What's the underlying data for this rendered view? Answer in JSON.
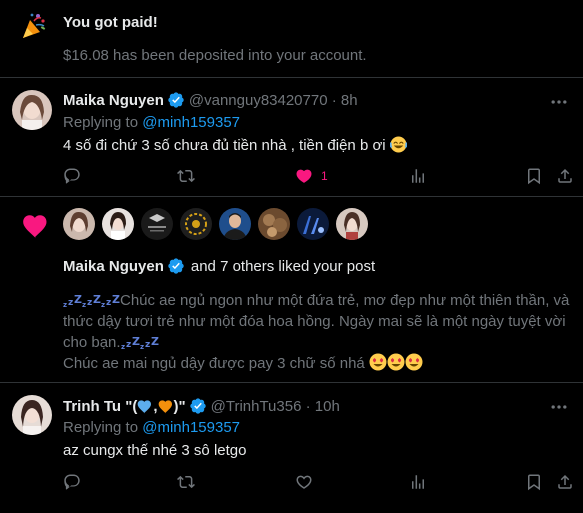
{
  "paid": {
    "title": "You got paid!",
    "description": "$16.08 has been deposited into your account."
  },
  "tweet1": {
    "name": "Maika Nguyen",
    "handle": "@vannguy83420770 · 8h",
    "replying_prefix": "Replying to ",
    "replying_mention": "@minh159357",
    "text": "4 số đi chứ 3 số chưa đủ tiền nhà , tiền điện b ơi",
    "like_count": "1"
  },
  "likes": {
    "name": "Maika Nguyen",
    "summary": "and 7 others liked your post",
    "post_line1": "Chúc ae ngủ ngon như một đứa trẻ, mơ đẹp như một thiên thần, và",
    "post_line2": "thức dậy tươi trẻ như một đóa hoa hồng. Ngày mai sẽ là một ngày tuyệt vời",
    "post_line3": "cho bạn.",
    "post_line4": "Chúc ae mai ngủ dậy được pay 3 chữ số nhá"
  },
  "tweet2": {
    "name": "Trinh Tu \"(",
    "name_mid": ",",
    "name_end": ")\"",
    "handle": "@TrinhTu356 · 10h",
    "replying_prefix": "Replying to ",
    "replying_mention": "@minh159357",
    "text": "az cungx thế nhé 3 sô letgo"
  },
  "icons": [
    "party-popper-icon",
    "verified-badge-icon",
    "more-icon",
    "reply-icon",
    "retweet-icon",
    "like-icon",
    "analytics-icon",
    "bookmark-icon",
    "share-icon",
    "heart-filled-icon",
    "sleeping-zzz-icon",
    "heart-eyes-emoji-icon",
    "joy-emoji-icon",
    "blue-heart-icon",
    "orange-heart-icon"
  ],
  "colors": {
    "background": "#000000",
    "text": "#e7e9ea",
    "muted": "#71767b",
    "accent": "#1d9bf0",
    "like": "#f91880",
    "divider": "#2f3336"
  }
}
